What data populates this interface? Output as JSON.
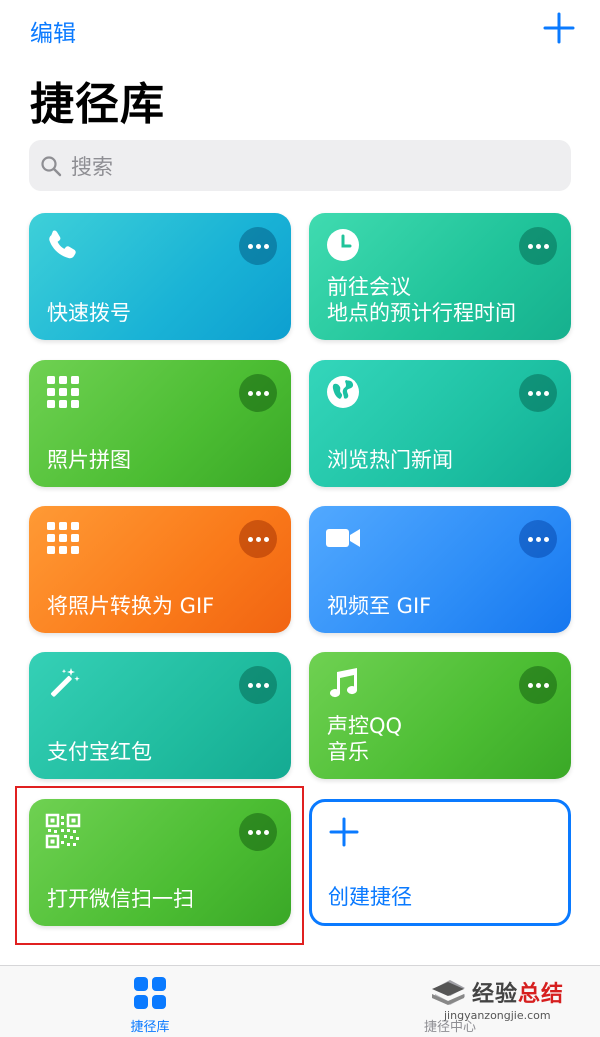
{
  "nav": {
    "edit_label": "编辑"
  },
  "header": {
    "title": "捷径库"
  },
  "search": {
    "placeholder": "搜索"
  },
  "shortcuts": [
    {
      "label": "快速拨号",
      "icon": "phone-icon"
    },
    {
      "label": "前往会议\n地点的预计行程时间",
      "icon": "clock-icon"
    },
    {
      "label": "照片拼图",
      "icon": "grid-icon"
    },
    {
      "label": "浏览热门新闻",
      "icon": "globe-icon"
    },
    {
      "label": "将照片转换为 GIF",
      "icon": "grid-icon"
    },
    {
      "label": "视频至 GIF",
      "icon": "video-camera-icon"
    },
    {
      "label": "支付宝红包",
      "icon": "magic-wand-icon"
    },
    {
      "label": "声控QQ\n音乐",
      "icon": "music-note-icon"
    },
    {
      "label": "打开微信扫一扫",
      "icon": "qr-code-icon"
    }
  ],
  "create": {
    "label": "创建捷径"
  },
  "tabs": [
    {
      "label": "捷径库",
      "icon": "library-grid-icon"
    },
    {
      "label": "捷径中心",
      "icon": "layers-icon"
    }
  ],
  "watermark": {
    "brand_a": "经验",
    "brand_b": "总结",
    "url": "jingyanzongjie.com"
  },
  "colors": {
    "accent": "#0a7aff",
    "highlight": "#e02020"
  }
}
